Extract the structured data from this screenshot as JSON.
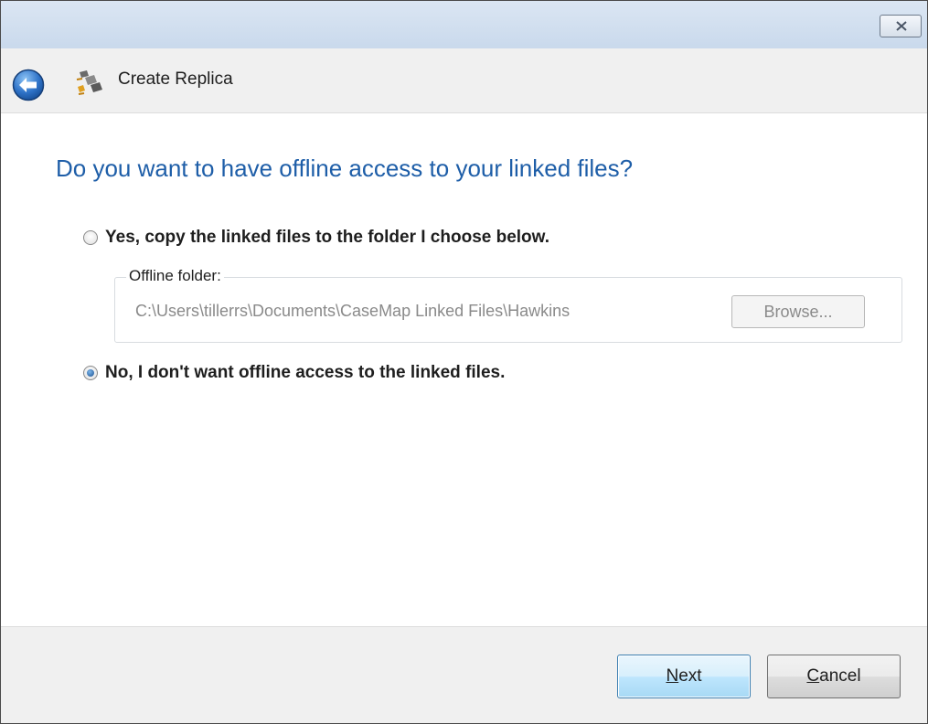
{
  "window": {
    "title": "Create Replica"
  },
  "page": {
    "heading": "Do you want to have offline access to your linked files?"
  },
  "options": {
    "yes": {
      "label": "Yes, copy the linked files to the folder I choose below.",
      "checked": false
    },
    "no": {
      "label": "No, I don't want offline access to the linked files.",
      "checked": true
    }
  },
  "offline_folder": {
    "group_label": "Offline folder:",
    "path": "C:\\Users\\tillerrs\\Documents\\CaseMap Linked Files\\Hawkins",
    "browse_label": "Browse..."
  },
  "footer": {
    "next": {
      "mnemonic": "N",
      "rest": "ext"
    },
    "cancel": {
      "mnemonic": "C",
      "rest": "ancel"
    }
  },
  "colors": {
    "heading": "#1e5ea8",
    "titlebar": "#c9d9ec",
    "back_button": "#2f73c8",
    "next_border": "#3c7fb1"
  }
}
